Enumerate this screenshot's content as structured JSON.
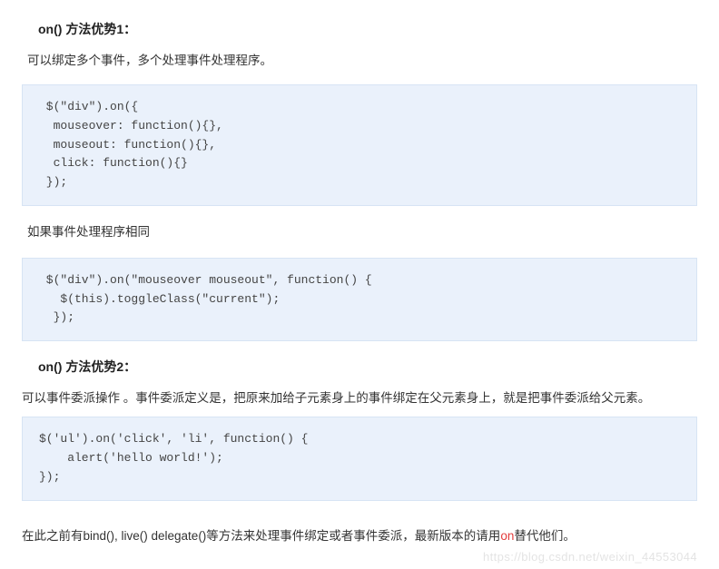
{
  "section1": {
    "heading": "on() 方法优势1：",
    "intro": "可以绑定多个事件，多个处理事件处理程序。",
    "code1": " $(\"div\").on({\n  mouseover: function(){},\n  mouseout: function(){},\n  click: function(){}\n });",
    "note": "如果事件处理程序相同",
    "code2": " $(\"div\").on(\"mouseover mouseout\", function() {\n   $(this).toggleClass(\"current\");\n  });"
  },
  "section2": {
    "heading": "on() 方法优势2：",
    "intro": "可以事件委派操作 。事件委派定义是，把原来加给子元素身上的事件绑定在父元素身上，就是把事件委派给父元素。",
    "code": "$('ul').on('click', 'li', function() {\n    alert('hello world!');\n});"
  },
  "final": {
    "before": "在此之前有bind(), live() delegate()等方法来处理事件绑定或者事件委派，最新版本的请用",
    "highlight": "on",
    "after": "替代他们。"
  },
  "watermark": "https://blog.csdn.net/weixin_44553044"
}
